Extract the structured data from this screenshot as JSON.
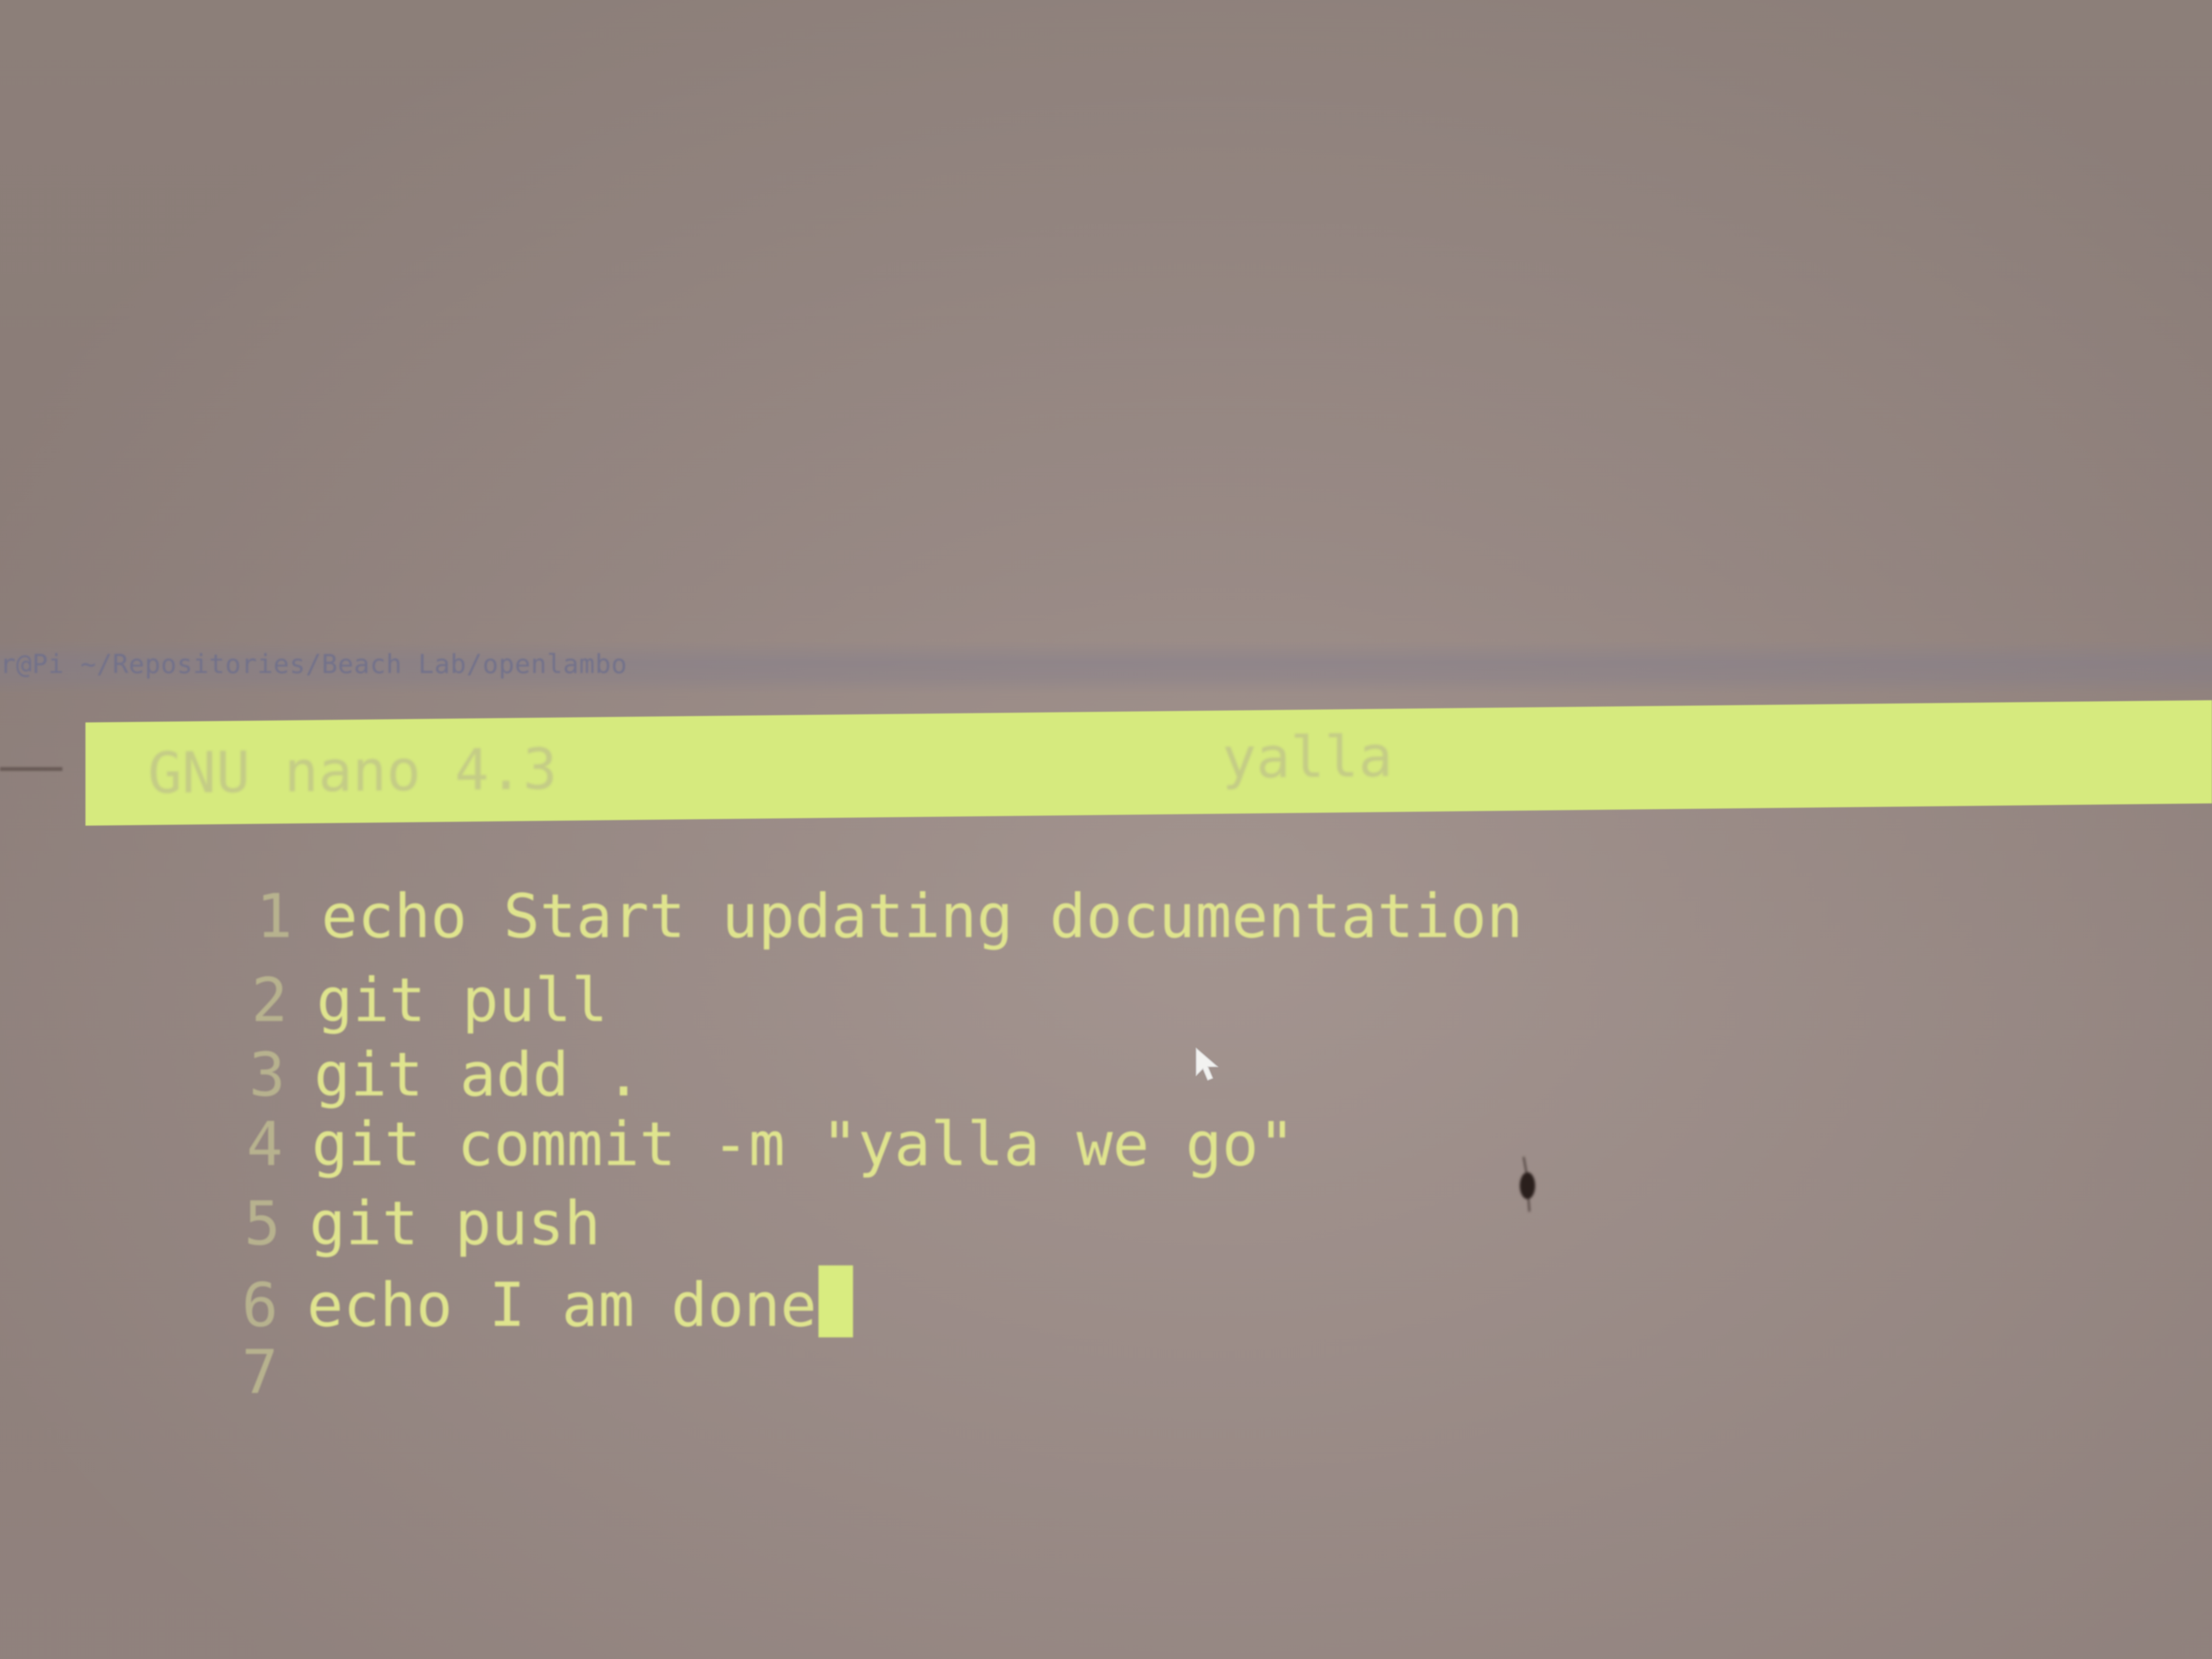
{
  "window": {
    "title": "r@Pi ~/Repositories/Beach Lab/openlambo"
  },
  "nano": {
    "version": "GNU nano 4.3",
    "filename": "yalla"
  },
  "editor": {
    "lines": [
      {
        "number": "1",
        "text": "echo Start updating documentation"
      },
      {
        "number": "2",
        "text": "git pull"
      },
      {
        "number": "3",
        "text": "git add ."
      },
      {
        "number": "4",
        "text": "git commit -m \"yalla we go\""
      },
      {
        "number": "5",
        "text": "git push"
      },
      {
        "number": "6",
        "text": "echo I am done"
      },
      {
        "number": "7",
        "text": ""
      }
    ]
  },
  "colors": {
    "header_bg": "#d6ea7e",
    "text": "#dfe48e",
    "line_number": "#b7b28e",
    "background": "#9c8d87"
  },
  "icons": {
    "pointer": "mouse-pointer-icon",
    "cursor": "text-cursor-block"
  }
}
